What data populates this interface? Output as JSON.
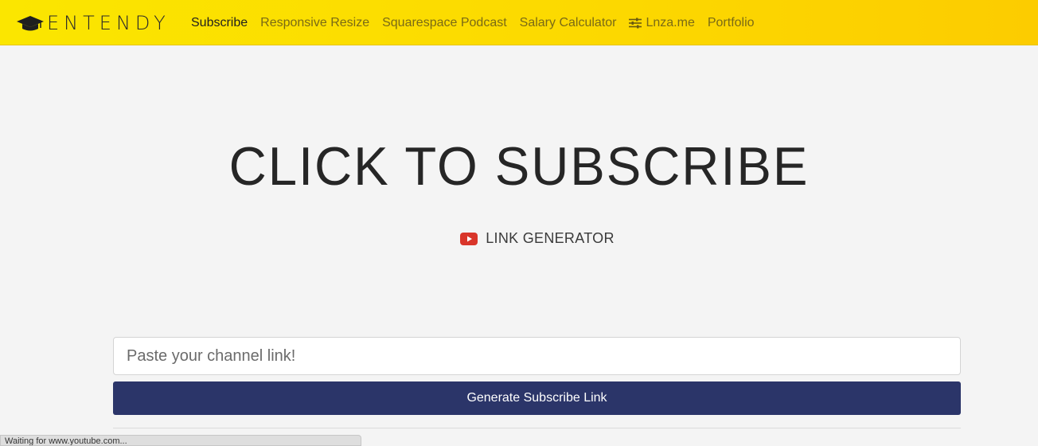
{
  "brand": {
    "name": "ENTENDY",
    "icon": "graduation-cap-icon"
  },
  "nav": {
    "items": [
      {
        "label": "Subscribe",
        "active": true
      },
      {
        "label": "Responsive Resize",
        "active": false
      },
      {
        "label": "Squarespace Podcast",
        "active": false
      },
      {
        "label": "Salary Calculator",
        "active": false
      },
      {
        "label": "Lnza.me",
        "active": false,
        "icon": "sliders-icon"
      },
      {
        "label": "Portfolio",
        "active": false
      }
    ]
  },
  "hero": {
    "title": "CLICK TO SUBSCRIBE",
    "subtitle": "LINK GENERATOR",
    "subtitle_icon": "youtube-icon"
  },
  "form": {
    "placeholder": "Paste your channel link!",
    "value": "",
    "button_label": "Generate Subscribe Link"
  },
  "status": {
    "text": "Waiting for www.youtube.com..."
  },
  "colors": {
    "navbar": "#fcd800",
    "button": "#2b3569",
    "youtube": "#d9352a",
    "background": "#f4f4f4"
  }
}
